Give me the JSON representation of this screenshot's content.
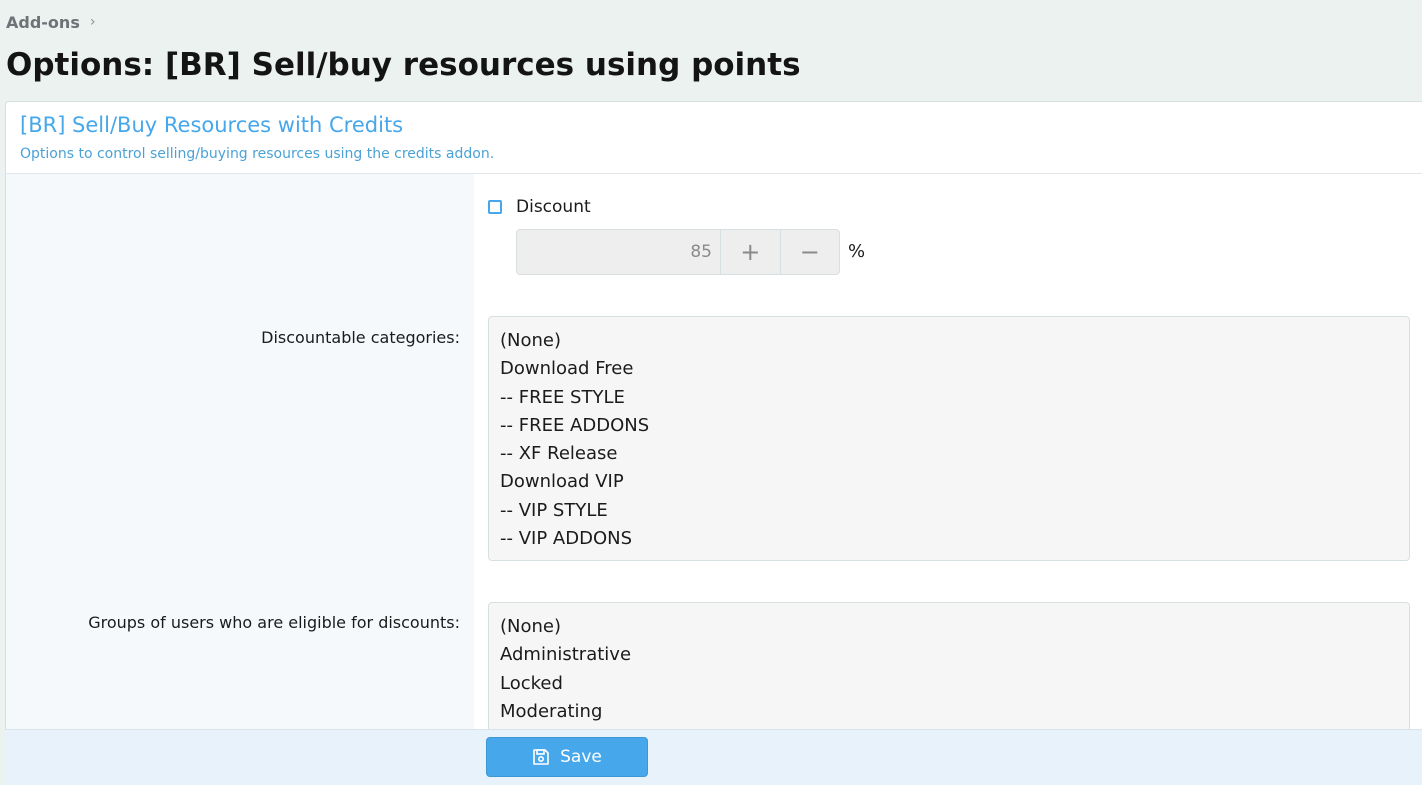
{
  "breadcrumb": {
    "items": [
      "Add-ons"
    ],
    "separator": "›"
  },
  "page": {
    "title": "Options: [BR] Sell/buy resources using points"
  },
  "panel": {
    "title": "[BR] Sell/Buy Resources with Credits",
    "description": "Options to control selling/buying resources using the credits addon."
  },
  "discount": {
    "checkbox_label": "Discount",
    "checked": false,
    "value": "85",
    "plus_label": "+",
    "minus_label": "−",
    "unit": "%"
  },
  "categories": {
    "label": "Discountable categories:",
    "items": [
      "(None)",
      "Download Free",
      "-- FREE STYLE",
      "-- FREE ADDONS",
      "-- XF Release",
      "Download VIP",
      "-- VIP STYLE",
      "-- VIP ADDONS"
    ]
  },
  "groups": {
    "label": "Groups of users who are eligible for discounts:",
    "items": [
      "(None)",
      "Administrative",
      "Locked",
      "Moderating"
    ]
  },
  "footer": {
    "save_label": "Save",
    "save_icon": "floppy-disk-icon"
  },
  "colors": {
    "accent": "#47a7eb",
    "accent_text": "#4aa2d6",
    "footer_bg": "#e7f2fb",
    "page_bg": "#ebf2f0"
  }
}
